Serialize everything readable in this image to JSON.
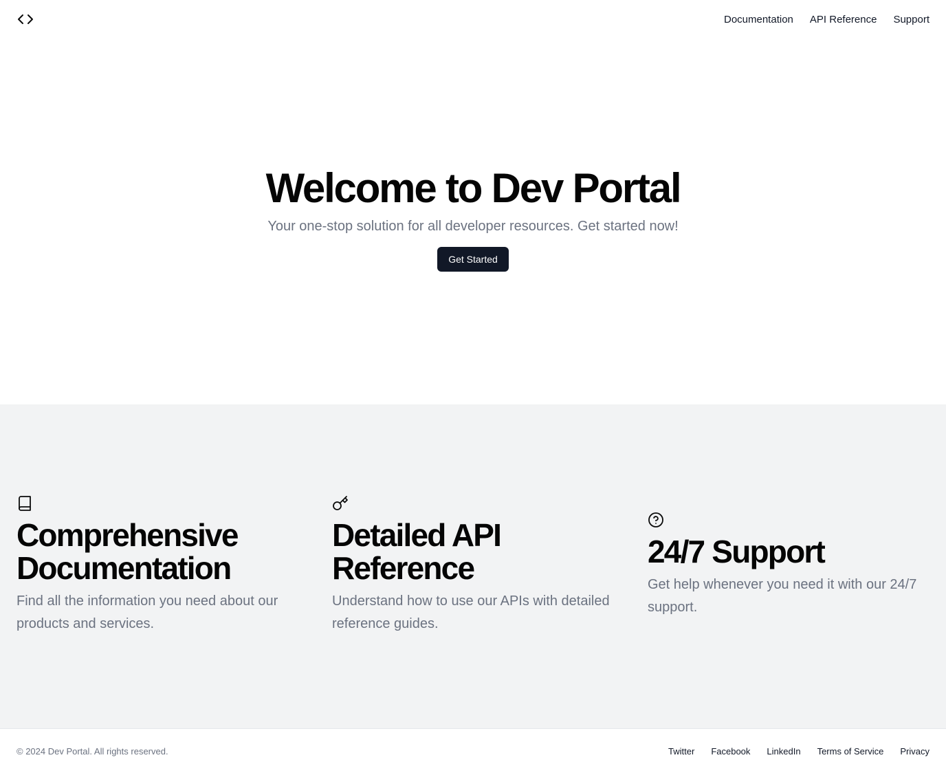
{
  "header": {
    "logo_icon": "code-brackets-icon",
    "nav": [
      {
        "label": "Documentation"
      },
      {
        "label": "API Reference"
      },
      {
        "label": "Support"
      }
    ]
  },
  "hero": {
    "title": "Welcome to Dev Portal",
    "subtitle": "Your one-stop solution for all developer resources. Get started now!",
    "cta_label": "Get Started"
  },
  "features": [
    {
      "icon": "book-icon",
      "title": "Comprehensive Documentation",
      "description": "Find all the information you need about our products and services."
    },
    {
      "icon": "key-icon",
      "title": "Detailed API Reference",
      "description": "Understand how to use our APIs with detailed reference guides."
    },
    {
      "icon": "help-circle-icon",
      "title": "24/7 Support",
      "description": "Get help whenever you need it with our 24/7 support."
    }
  ],
  "footer": {
    "copyright": "© 2024 Dev Portal. All rights reserved.",
    "links": [
      {
        "label": "Twitter"
      },
      {
        "label": "Facebook"
      },
      {
        "label": "LinkedIn"
      },
      {
        "label": "Terms of Service"
      },
      {
        "label": "Privacy"
      }
    ]
  },
  "colors": {
    "primary_button": "#111827",
    "features_background": "#f2f3f4",
    "muted_text": "#6b7280"
  }
}
